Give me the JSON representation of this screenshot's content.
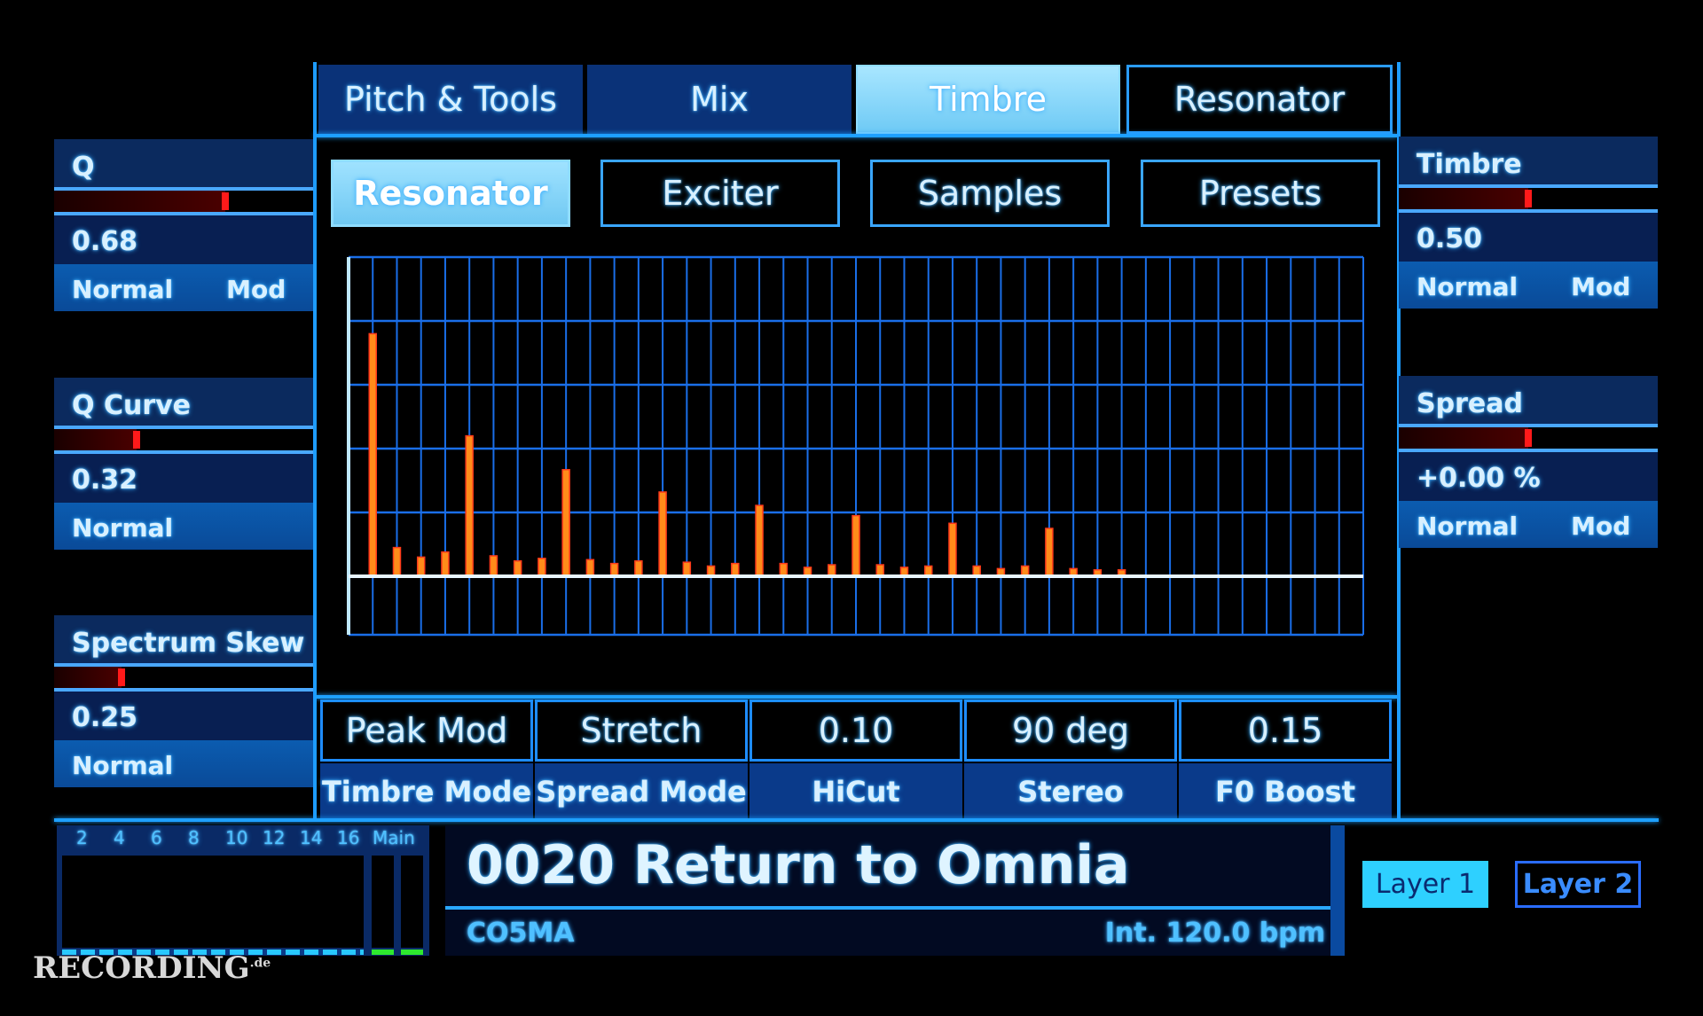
{
  "tabs": [
    {
      "label": "Pitch & Tools",
      "state": "normal"
    },
    {
      "label": "Mix",
      "state": "normal"
    },
    {
      "label": "Timbre",
      "state": "active"
    },
    {
      "label": "Resonator",
      "state": "outline"
    }
  ],
  "subtabs": [
    {
      "label": "Resonator",
      "active": true
    },
    {
      "label": "Exciter"
    },
    {
      "label": "Samples"
    },
    {
      "label": "Presets"
    }
  ],
  "left_panels": [
    {
      "title": "Q",
      "value": "0.68",
      "level": 0.66,
      "modes": [
        "Normal",
        "Mod"
      ]
    },
    {
      "title": "Q Curve",
      "value": "0.32",
      "level": 0.32,
      "modes": [
        "Normal"
      ]
    },
    {
      "title": "Spectrum Skew",
      "value": "0.25",
      "level": 0.26,
      "modes": [
        "Normal"
      ]
    }
  ],
  "right_panels": [
    {
      "title": "Timbre",
      "value": "0.50",
      "level": 0.5,
      "modes": [
        "Normal",
        "Mod"
      ]
    },
    {
      "title": "Spread",
      "value": "+0.00 %",
      "level": 0.5,
      "modes": [
        "Normal",
        "Mod"
      ]
    }
  ],
  "params": [
    {
      "value": "Peak Mod",
      "label": "Timbre Mode"
    },
    {
      "value": "Stretch",
      "label": "Spread Mode"
    },
    {
      "value": "0.10",
      "label": "HiCut"
    },
    {
      "value": "90 deg",
      "label": "Stereo"
    },
    {
      "value": "0.15",
      "label": "F0 Boost"
    }
  ],
  "meter": {
    "labels": [
      "2",
      "4",
      "6",
      "8",
      "10",
      "12",
      "14",
      "16"
    ],
    "main_label": "Main"
  },
  "preset": {
    "name": "0020 Return to Omnia",
    "category": "CO5MA",
    "tempo": "Int. 120.0 bpm"
  },
  "layers": [
    {
      "label": "Layer 1",
      "active": true
    },
    {
      "label": "Layer 2",
      "active": false
    }
  ],
  "watermark": "RECORDING.de",
  "colors": {
    "accent": "#1ea0ff",
    "bar": "#ff8c1a",
    "marker": "#ff1a1a",
    "active_tab": "#8fdcff"
  },
  "chart_data": {
    "type": "bar",
    "grid": true,
    "ylim": [
      -0.9,
      5
    ],
    "values": [
      3.8,
      0.45,
      0.3,
      0.38,
      2.2,
      0.32,
      0.24,
      0.28,
      1.67,
      0.26,
      0.2,
      0.24,
      1.32,
      0.22,
      0.16,
      0.2,
      1.11,
      0.2,
      0.14,
      0.18,
      0.95,
      0.18,
      0.14,
      0.16,
      0.83,
      0.16,
      0.12,
      0.16,
      0.75,
      0.12,
      0.1,
      0.1
    ]
  }
}
